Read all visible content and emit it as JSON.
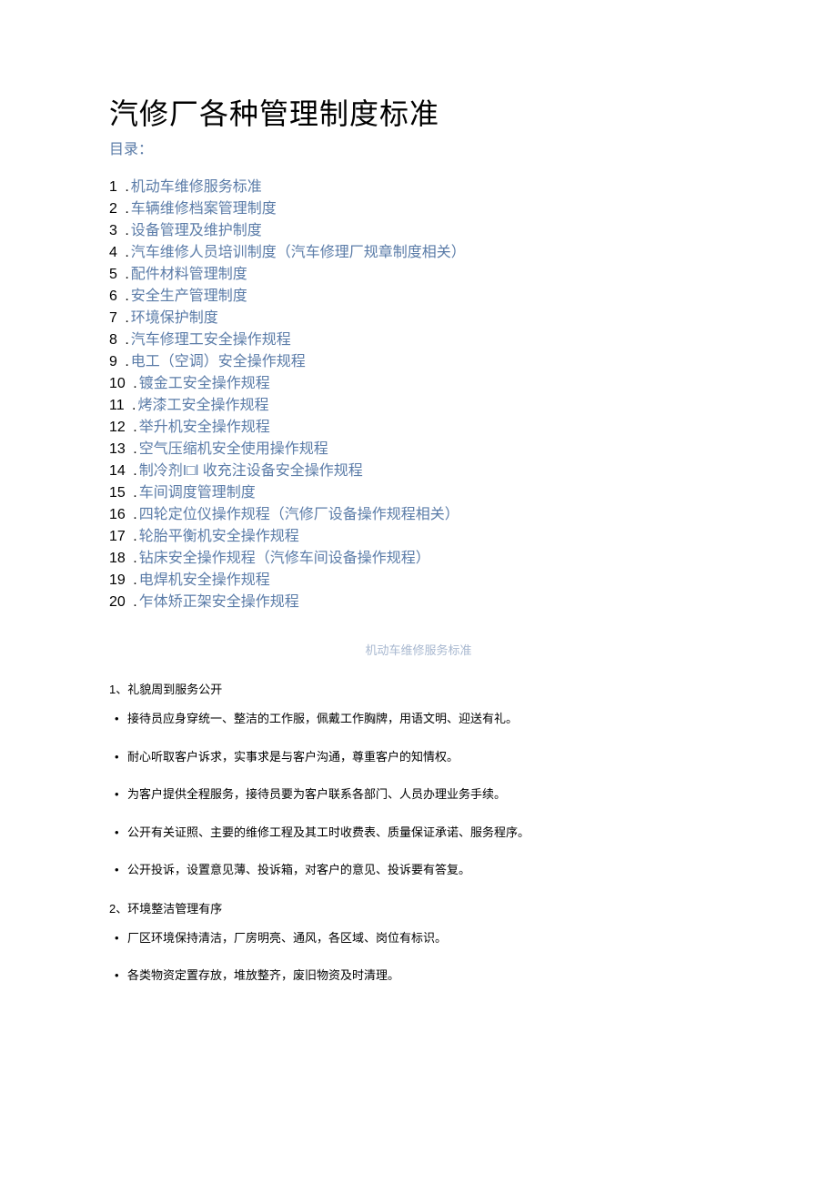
{
  "title": "汽修厂各种管理制度标准",
  "toc_label": "目录：",
  "toc_items": [
    {
      "num": "1",
      "text": "机动车维修服务标准"
    },
    {
      "num": "2",
      "text": "车辆维修档案管理制度"
    },
    {
      "num": "3",
      "text": "设备管理及维护制度"
    },
    {
      "num": "4",
      "text": "汽车维修人员培训制度（汽车修理厂规章制度相关）"
    },
    {
      "num": "5",
      "text": "配件材料管理制度"
    },
    {
      "num": "6",
      "text": "安全生产管理制度"
    },
    {
      "num": "7",
      "text": "环境保护制度"
    },
    {
      "num": "8",
      "text": "汽车修理工安全操作规程"
    },
    {
      "num": "9",
      "text": "电工（空调）安全操作规程"
    },
    {
      "num": "10",
      "text": "镀金工安全操作规程"
    },
    {
      "num": "11",
      "text": "烤漆工安全操作规程"
    },
    {
      "num": "12",
      "text": "举升机安全操作规程"
    },
    {
      "num": "13",
      "text": "空气压缩机安全使用操作规程"
    },
    {
      "num": "14",
      "text": "制冷剂I□l 收充注设备安全操作规程"
    },
    {
      "num": "15",
      "text": "车间调度管理制度"
    },
    {
      "num": "16",
      "text": "四轮定位仪操作规程（汽修厂设备操作规程相关）"
    },
    {
      "num": "17",
      "text": "轮胎平衡机安全操作规程"
    },
    {
      "num": "18",
      "text": "钻床安全操作规程（汽修车间设备操作规程）"
    },
    {
      "num": "19",
      "text": "电焊机安全操作规程"
    },
    {
      "num": "20",
      "text": "乍体矫正架安全操作规程"
    }
  ],
  "section1": {
    "heading": "机动车维修服务标准",
    "sub1_label": "1、礼貌周到服务公开",
    "sub1_items": [
      "接待员应身穿统一、整洁的工作服，佩戴工作胸牌，用语文明、迎送有礼。",
      "耐心听取客户诉求，实事求是与客户沟通，尊重客户的知情权。",
      "为客户提供全程服务，接待员要为客户联系各部门、人员办理业务手续。",
      "公开有关证照、主要的维修工程及其工时收费表、质量保证承诺、服务程序。",
      "公开投诉，设置意见薄、投诉箱，对客户的意见、投诉要有答复。"
    ],
    "sub2_label": "2、环境整洁管理有序",
    "sub2_items": [
      "厂区环境保持清洁，厂房明亮、通风，各区域、岗位有标识。",
      "各类物资定置存放，堆放整齐，废旧物资及时清理。"
    ]
  }
}
